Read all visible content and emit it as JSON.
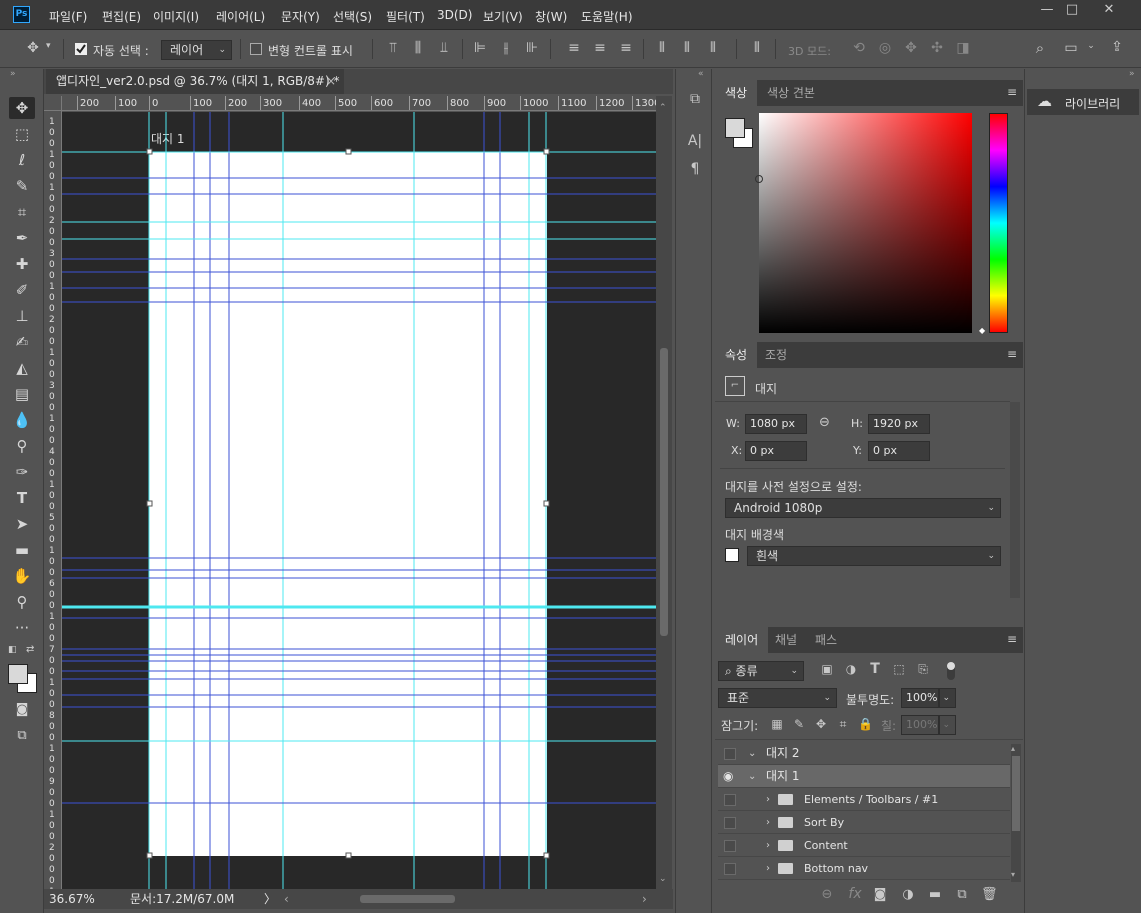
{
  "app": {
    "logo": "Ps"
  },
  "menu": [
    "파일(F)",
    "편집(E)",
    "이미지(I)",
    "레이어(L)",
    "문자(Y)",
    "선택(S)",
    "필터(T)",
    "3D(D)",
    "보기(V)",
    "창(W)",
    "도움말(H)"
  ],
  "window_controls": {
    "minimize": "—",
    "maximize": "□",
    "close": "✕"
  },
  "options": {
    "auto_select_label": "자동 선택 :",
    "auto_select_checked": true,
    "auto_select_target": "레이어",
    "transform_label": "변형 컨트롤 표시",
    "mode3d_label": "3D 모드:"
  },
  "document": {
    "tab_title": "앱디자인_ver2.0.psd @ 36.7% (대지 1, RGB/8#) *",
    "close": "×",
    "artboard_label": "대지 1",
    "ruler_top": [
      "200",
      "100",
      "0",
      "100",
      "200",
      "300",
      "400",
      "500",
      "600",
      "700",
      "800",
      "900",
      "1000",
      "1100",
      "1200",
      "1300"
    ],
    "ruler_left": [
      "1",
      "0",
      "0",
      "1",
      "0",
      "0",
      "1",
      "0",
      "0",
      "2",
      "0",
      "0",
      "3",
      "0",
      "0",
      "1",
      "0",
      "0",
      "2",
      "0",
      "0",
      "1",
      "0",
      "0",
      "3",
      "0",
      "0",
      "1",
      "0",
      "0",
      "4",
      "0",
      "0",
      "1",
      "0",
      "0",
      "5",
      "0",
      "0",
      "1",
      "0",
      "0",
      "6",
      "0",
      "0",
      "1",
      "0",
      "0",
      "7",
      "0",
      "0",
      "1",
      "0",
      "0",
      "8",
      "0",
      "0",
      "1",
      "0",
      "0",
      "9",
      "0",
      "0",
      "1",
      "0",
      "0",
      "2",
      "0",
      "0",
      "0",
      "1"
    ]
  },
  "status": {
    "zoom": "36.67%",
    "doc": "문서:17.2M/67.0M",
    "arrow": "〉"
  },
  "color_panel": {
    "tabs": [
      "색상",
      "색상 견본"
    ]
  },
  "properties_panel": {
    "tabs": [
      "속성",
      "조정"
    ],
    "type_label": "대지",
    "w_label": "W:",
    "w_value": "1080 px",
    "h_label": "H:",
    "h_value": "1920 px",
    "x_label": "X:",
    "x_value": "0 px",
    "y_label": "Y:",
    "y_value": "0 px",
    "preset_label": "대지를 사전 설정으로 설정:",
    "preset_value": "Android 1080p",
    "bg_label": "대지 배경색",
    "bg_value": "흰색"
  },
  "layers_panel": {
    "tabs": [
      "레이어",
      "채널",
      "패스"
    ],
    "filter_kind": "종류",
    "blend_mode": "표준",
    "opacity_label": "불투명도:",
    "opacity_value": "100%",
    "lock_label": "잠그기:",
    "fill_label": "칠:",
    "fill_value": "100%",
    "layers": [
      {
        "name": "대지 2",
        "visible": false,
        "selected": false,
        "indent": 0,
        "type": "artboard"
      },
      {
        "name": "대지 1",
        "visible": true,
        "selected": true,
        "indent": 0,
        "type": "artboard"
      },
      {
        "name": "Elements / Toolbars / #1",
        "visible": false,
        "selected": false,
        "indent": 1,
        "type": "group"
      },
      {
        "name": "Sort By",
        "visible": false,
        "selected": false,
        "indent": 1,
        "type": "group"
      },
      {
        "name": "Content",
        "visible": false,
        "selected": false,
        "indent": 1,
        "type": "group"
      },
      {
        "name": "Bottom nav",
        "visible": false,
        "selected": false,
        "indent": 1,
        "type": "group"
      }
    ]
  },
  "library_panel": {
    "title": "라이브러리"
  },
  "colors": {
    "fg": "#d9d9d9",
    "bg": "#ffffff",
    "guide_cyan": "#4ee8f0",
    "guide_blue": "#3b52d6",
    "selected_row": "#686868"
  }
}
